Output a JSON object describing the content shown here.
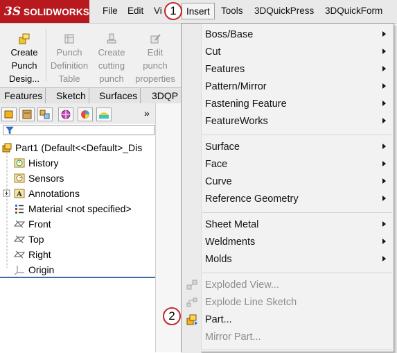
{
  "app": {
    "logo_ds": "3S",
    "logo_text": "SOLIDWORKS"
  },
  "menubar": {
    "file": "File",
    "edit": "Edit",
    "view": "Vi",
    "insert": "Insert",
    "tools": "Tools",
    "quickpress": "3DQuickPress",
    "quickform": "3DQuickForm"
  },
  "callouts": {
    "one": "1",
    "two": "2"
  },
  "commands": [
    {
      "lines": [
        "Create",
        "Punch",
        "Desig..."
      ],
      "icon": "create-punch-icon",
      "enabled": true
    },
    {
      "lines": [
        "Punch",
        "Definition",
        "Table"
      ],
      "icon": "punch-table-icon",
      "enabled": false
    },
    {
      "lines": [
        "Create",
        "cutting",
        "punch"
      ],
      "icon": "cutting-punch-icon",
      "enabled": false
    },
    {
      "lines": [
        "Edit",
        "punch",
        "properties"
      ],
      "icon": "edit-punch-icon",
      "enabled": false
    }
  ],
  "tabs": [
    "Features",
    "Sketch",
    "Surfaces",
    "3DQP"
  ],
  "featuremanager": {
    "expand_glyph": "»",
    "part": "Part1  (Default<<Default>_Dis",
    "items": [
      {
        "label": "History",
        "icon": "history-icon"
      },
      {
        "label": "Sensors",
        "icon": "sensors-icon"
      },
      {
        "label": "Annotations",
        "icon": "annotations-icon"
      },
      {
        "label": "Material <not specified>",
        "icon": "material-icon"
      },
      {
        "label": "Front",
        "icon": "plane-icon"
      },
      {
        "label": "Top",
        "icon": "plane-icon"
      },
      {
        "label": "Right",
        "icon": "plane-icon"
      },
      {
        "label": "Origin",
        "icon": "origin-icon"
      }
    ]
  },
  "insert_menu": {
    "group1": [
      "Boss/Base",
      "Cut",
      "Features",
      "Pattern/Mirror",
      "Fastening Feature",
      "FeatureWorks"
    ],
    "group2": [
      "Surface",
      "Face",
      "Curve",
      "Reference Geometry"
    ],
    "group3": [
      "Sheet Metal",
      "Weldments",
      "Molds"
    ],
    "group4": [
      {
        "label": "Exploded View...",
        "enabled": false,
        "icon": "exploded-view-icon"
      },
      {
        "label": "Explode Line Sketch",
        "enabled": false,
        "icon": "explode-line-icon"
      },
      {
        "label": "Part...",
        "enabled": true,
        "icon": "insert-part-icon"
      },
      {
        "label": "Mirror Part...",
        "enabled": false,
        "icon": ""
      }
    ]
  },
  "colors": {
    "brand_red": "#b8191f",
    "callout_red": "#c0272d",
    "selection_blue": "#3d6ca8"
  }
}
